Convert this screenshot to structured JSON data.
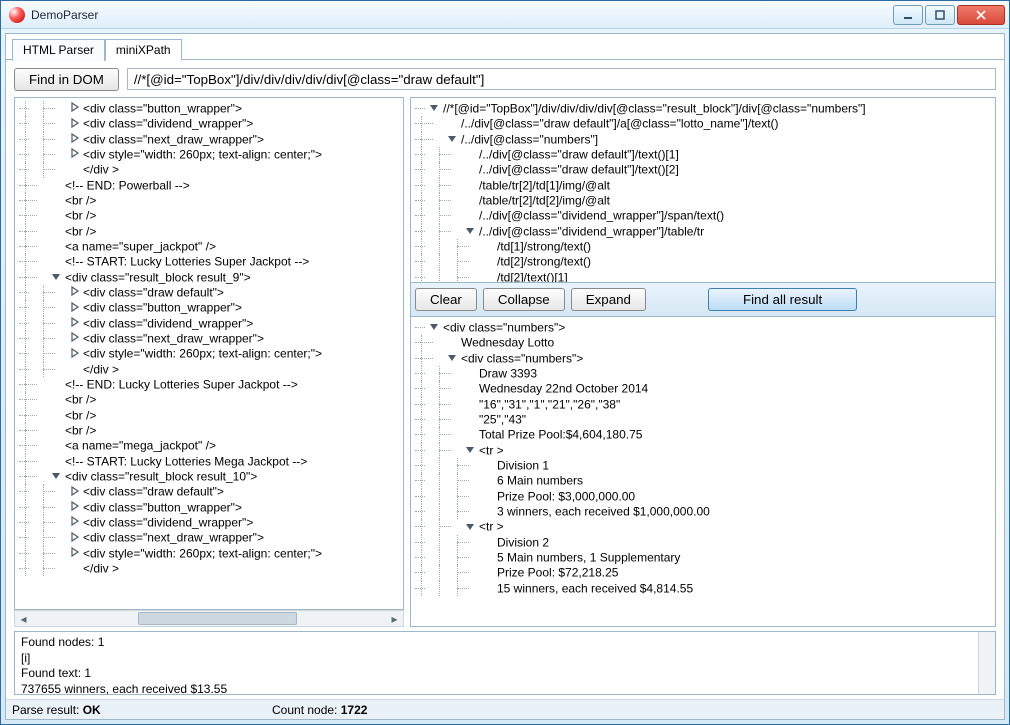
{
  "window": {
    "title": "DemoParser"
  },
  "titlebar_buttons": {
    "min": "minimize",
    "max": "maximize",
    "close": "close"
  },
  "tabs": [
    "HTML Parser",
    "miniXPath"
  ],
  "active_tab_index": 1,
  "toolbar": {
    "find_in_dom": "Find in DOM",
    "xpath_value": "//*[@id=\"TopBox\"]/div/div/div/div/div[@class=\"draw default\"]"
  },
  "left_tree": [
    {
      "d": 3,
      "t": "closed",
      "x": "<div class=\"button_wrapper\">"
    },
    {
      "d": 3,
      "t": "closed",
      "x": "<div class=\"dividend_wrapper\">"
    },
    {
      "d": 3,
      "t": "closed",
      "x": "<div class=\"next_draw_wrapper\">"
    },
    {
      "d": 3,
      "t": "closed",
      "x": "<div style=\"width: 260px; text-align: center;\">"
    },
    {
      "d": 3,
      "t": "leaf",
      "x": "</div >"
    },
    {
      "d": 2,
      "t": "leaf",
      "x": "<!-- END: Powerball -->"
    },
    {
      "d": 2,
      "t": "leaf",
      "x": "<br />"
    },
    {
      "d": 2,
      "t": "leaf",
      "x": "<br />"
    },
    {
      "d": 2,
      "t": "leaf",
      "x": "<br />"
    },
    {
      "d": 2,
      "t": "leaf",
      "x": "<a name=\"super_jackpot\" />"
    },
    {
      "d": 2,
      "t": "leaf",
      "x": "<!-- START: Lucky Lotteries Super Jackpot -->"
    },
    {
      "d": 2,
      "t": "open",
      "x": "<div class=\"result_block result_9\">"
    },
    {
      "d": 3,
      "t": "closed",
      "x": "<div class=\"draw default\">"
    },
    {
      "d": 3,
      "t": "closed",
      "x": "<div class=\"button_wrapper\">"
    },
    {
      "d": 3,
      "t": "closed",
      "x": "<div class=\"dividend_wrapper\">"
    },
    {
      "d": 3,
      "t": "closed",
      "x": "<div class=\"next_draw_wrapper\">"
    },
    {
      "d": 3,
      "t": "closed",
      "x": "<div style=\"width: 260px; text-align: center;\">"
    },
    {
      "d": 3,
      "t": "leaf",
      "x": "</div >"
    },
    {
      "d": 2,
      "t": "leaf",
      "x": "<!-- END: Lucky Lotteries Super Jackpot -->"
    },
    {
      "d": 2,
      "t": "leaf",
      "x": "<br />"
    },
    {
      "d": 2,
      "t": "leaf",
      "x": "<br />"
    },
    {
      "d": 2,
      "t": "leaf",
      "x": "<br />"
    },
    {
      "d": 2,
      "t": "leaf",
      "x": "<a name=\"mega_jackpot\" />"
    },
    {
      "d": 2,
      "t": "leaf",
      "x": "<!-- START: Lucky Lotteries Mega Jackpot -->"
    },
    {
      "d": 2,
      "t": "open",
      "x": "<div class=\"result_block result_10\">"
    },
    {
      "d": 3,
      "t": "closed",
      "x": "<div class=\"draw default\">"
    },
    {
      "d": 3,
      "t": "closed",
      "x": "<div class=\"button_wrapper\">"
    },
    {
      "d": 3,
      "t": "closed",
      "x": "<div class=\"dividend_wrapper\">"
    },
    {
      "d": 3,
      "t": "closed",
      "x": "<div class=\"next_draw_wrapper\">"
    },
    {
      "d": 3,
      "t": "closed",
      "x": "<div style=\"width: 260px; text-align: center;\">"
    },
    {
      "d": 3,
      "t": "leaf",
      "x": "</div >"
    }
  ],
  "right_top_tree": [
    {
      "d": 0,
      "t": "open",
      "x": "//*[@id=\"TopBox\"]/div/div/div/div[@class=\"result_block\"]/div[@class=\"numbers\"]"
    },
    {
      "d": 1,
      "t": "leaf",
      "x": "/../div[@class=\"draw default\"]/a[@class=\"lotto_name\"]/text()"
    },
    {
      "d": 1,
      "t": "open",
      "x": "/../div[@class=\"numbers\"]"
    },
    {
      "d": 2,
      "t": "leaf",
      "x": "/../div[@class=\"draw default\"]/text()[1]"
    },
    {
      "d": 2,
      "t": "leaf",
      "x": "/../div[@class=\"draw default\"]/text()[2]"
    },
    {
      "d": 2,
      "t": "leaf",
      "x": "/table/tr[2]/td[1]/img/@alt"
    },
    {
      "d": 2,
      "t": "leaf",
      "x": "/table/tr[2]/td[2]/img/@alt"
    },
    {
      "d": 2,
      "t": "leaf",
      "x": "/../div[@class=\"dividend_wrapper\"]/span/text()"
    },
    {
      "d": 2,
      "t": "open",
      "x": "/../div[@class=\"dividend_wrapper\"]/table/tr"
    },
    {
      "d": 3,
      "t": "leaf",
      "x": "/td[1]/strong/text()"
    },
    {
      "d": 3,
      "t": "leaf",
      "x": "/td[2]/strong/text()"
    },
    {
      "d": 3,
      "t": "leaf",
      "x": "/td[2]/text()[1]"
    }
  ],
  "action_buttons": {
    "clear": "Clear",
    "collapse": "Collapse",
    "expand": "Expand",
    "find_all": "Find all result"
  },
  "right_bottom_tree": [
    {
      "d": 0,
      "t": "open",
      "x": "<div class=\"numbers\">"
    },
    {
      "d": 1,
      "t": "leaf",
      "x": "Wednesday Lotto"
    },
    {
      "d": 1,
      "t": "open",
      "x": "<div class=\"numbers\">"
    },
    {
      "d": 2,
      "t": "leaf",
      "x": "Draw 3393"
    },
    {
      "d": 2,
      "t": "leaf",
      "x": "Wednesday 22nd October 2014"
    },
    {
      "d": 2,
      "t": "leaf",
      "x": "\"16\",\"31\",\"1\",\"21\",\"26\",\"38\""
    },
    {
      "d": 2,
      "t": "leaf",
      "x": "\"25\",\"43\""
    },
    {
      "d": 2,
      "t": "leaf",
      "x": "Total Prize Pool:$4,604,180.75"
    },
    {
      "d": 2,
      "t": "open",
      "x": "<tr >"
    },
    {
      "d": 3,
      "t": "leaf",
      "x": "Division 1"
    },
    {
      "d": 3,
      "t": "leaf",
      "x": "6 Main numbers"
    },
    {
      "d": 3,
      "t": "leaf",
      "x": "Prize Pool: $3,000,000.00"
    },
    {
      "d": 3,
      "t": "leaf",
      "x": "3 winners, each received $1,000,000.00"
    },
    {
      "d": 2,
      "t": "open",
      "x": "<tr >"
    },
    {
      "d": 3,
      "t": "leaf",
      "x": "Division 2"
    },
    {
      "d": 3,
      "t": "leaf",
      "x": "5 Main numbers, 1 Supplementary"
    },
    {
      "d": 3,
      "t": "leaf",
      "x": "Prize Pool: $72,218.25"
    },
    {
      "d": 3,
      "t": "leaf",
      "x": "15 winners, each received $4,814.55"
    }
  ],
  "status": {
    "line1": "Found nodes: 1",
    "line2": "[i]",
    "line3": "Found text: 1",
    "line4": "737655 winners, each received $13.55"
  },
  "parsebar": {
    "label1": "Parse result: ",
    "val1": "OK",
    "label2": "Count node: ",
    "val2": "1722"
  }
}
